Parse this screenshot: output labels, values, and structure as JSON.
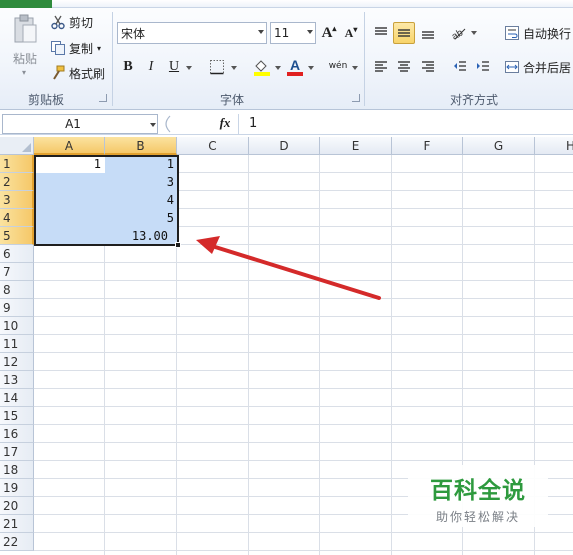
{
  "clipboard": {
    "paste_label": "粘贴",
    "cut_label": "剪切",
    "copy_label": "复制",
    "format_painter_label": "格式刷",
    "group_label": "剪贴板"
  },
  "font": {
    "family_value": "宋体",
    "size_value": "11",
    "group_label": "字体",
    "bold": "B",
    "italic": "I",
    "underline": "U",
    "phonetic": "wén"
  },
  "alignment": {
    "wrap_text_label": "自动换行",
    "merge_center_label": "合并后居",
    "group_label": "对齐方式"
  },
  "formula_bar": {
    "name_box_value": "A1",
    "fx_label": "fx",
    "formula_value": "1"
  },
  "grid": {
    "columns": [
      "A",
      "B",
      "C",
      "D",
      "E",
      "F",
      "G",
      "H"
    ],
    "rows": [
      "1",
      "2",
      "3",
      "4",
      "5",
      "6",
      "7",
      "8",
      "9",
      "10",
      "11",
      "12",
      "13",
      "14",
      "15",
      "16",
      "17",
      "18",
      "19",
      "20",
      "21",
      "22"
    ],
    "cells": {
      "A1": "1",
      "B1": "1",
      "B2": "3",
      "B3": "4",
      "B4": "5",
      "B5": "13.00"
    }
  },
  "watermark": {
    "title": "百科全说",
    "subtitle": "助你轻松解决"
  },
  "colors": {
    "selection": "#c6dcf7",
    "header_selected": "#f5c869",
    "arrow": "#d42a2a",
    "watermark_green": "#2e9a3e"
  }
}
